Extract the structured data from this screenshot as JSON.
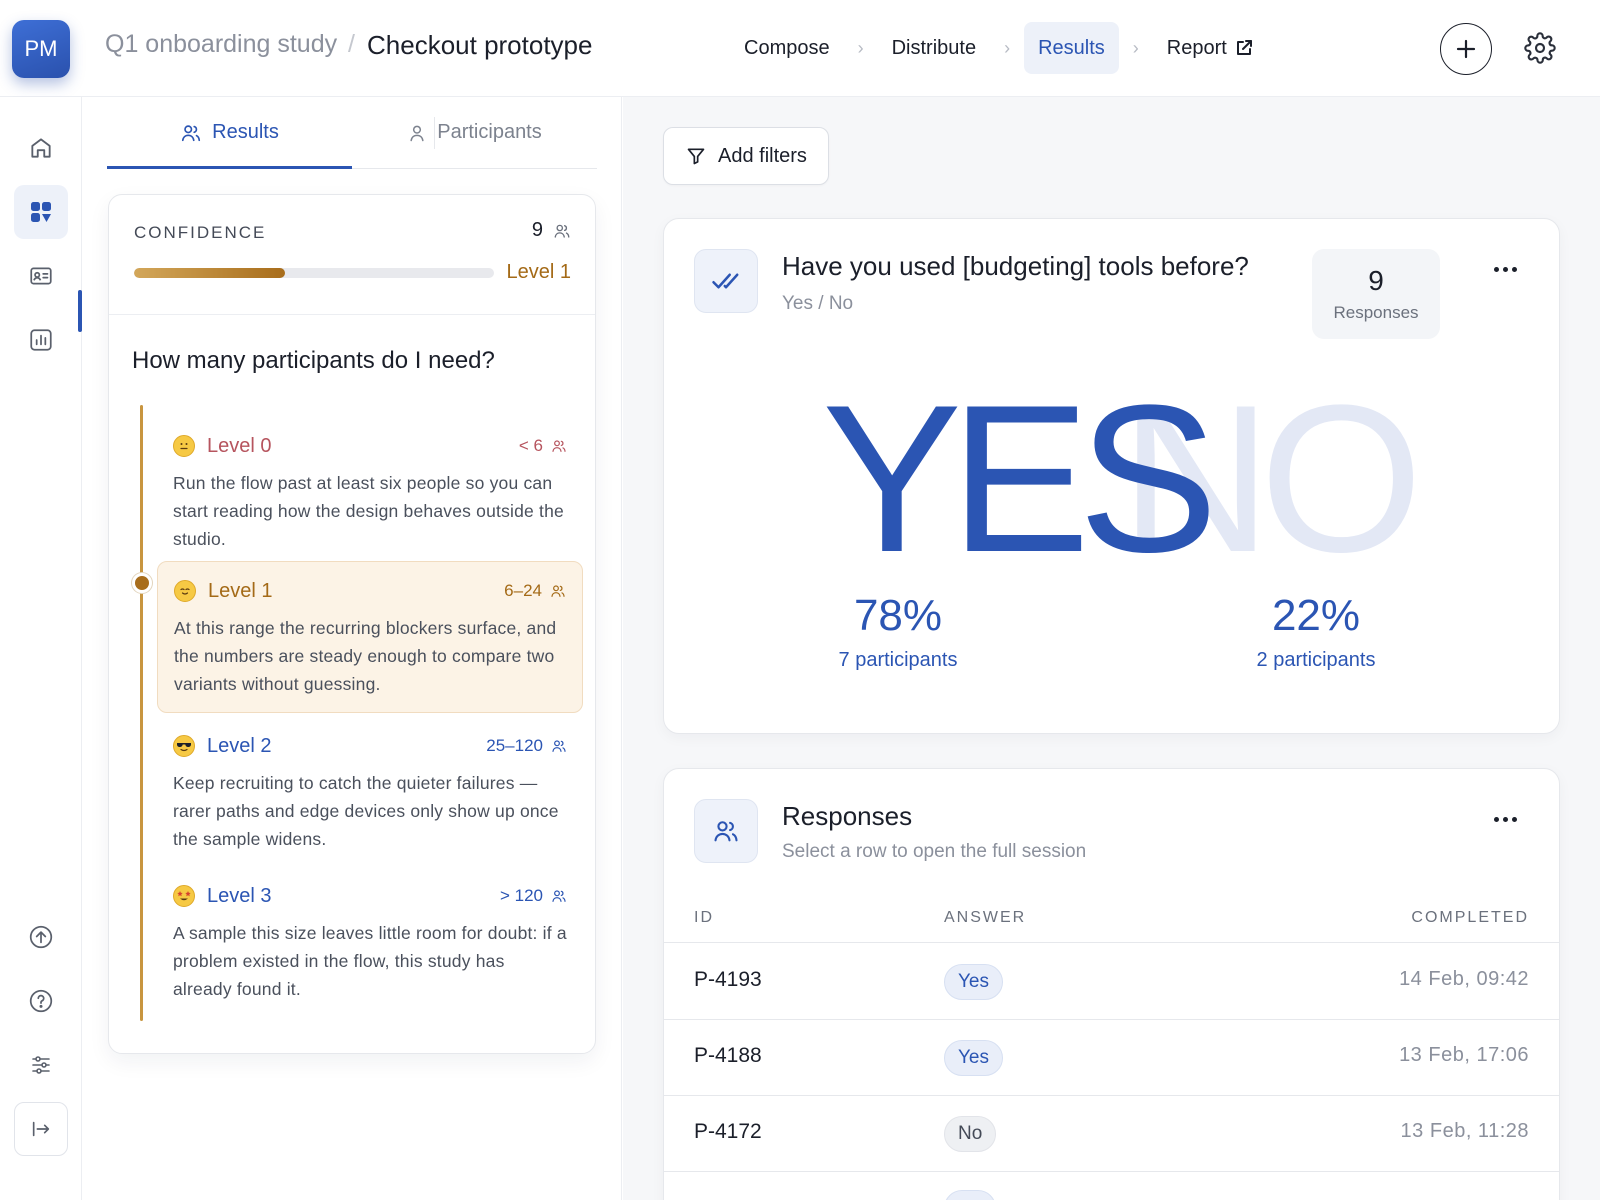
{
  "header": {
    "avatar_initials": "PM",
    "project": "Q1 onboarding study",
    "separator": "/",
    "page": "Checkout prototype",
    "steps": [
      {
        "label": "Compose"
      },
      {
        "label": "Distribute"
      },
      {
        "label": "Results"
      },
      {
        "label": "Report"
      }
    ],
    "active_step": "Results"
  },
  "left_tabs": [
    {
      "label": "Results"
    },
    {
      "label": "Participants"
    }
  ],
  "confidence": {
    "label": "CONFIDENCE",
    "count": "9",
    "progress": 0.42,
    "level": "Level 1",
    "question": "How many participants do I need?",
    "levels": [
      {
        "name": "Level 0",
        "range": "< 6",
        "desc": "Run the flow past at least six people so you can start reading how the design behaves outside the studio."
      },
      {
        "name": "Level 1",
        "range": "6–24",
        "desc": "At this range the recurring blockers surface, and the numbers are steady enough to compare two variants without guessing."
      },
      {
        "name": "Level 2",
        "range": "25–120",
        "desc": "Keep recruiting to catch the quieter failures — rarer paths and edge devices only show up once the sample widens."
      },
      {
        "name": "Level 3",
        "range": "> 120",
        "desc": "A sample this size leaves little room for doubt: if a problem existed in the flow, this study has already found it."
      }
    ]
  },
  "filters": {
    "label": "Add filters"
  },
  "question_card": {
    "title": "Have you used [budgeting] tools before?",
    "subtitle": "Yes / No",
    "responses_count": "9",
    "responses_label": "Responses",
    "yes_word": "YES",
    "no_word": "NO",
    "yes_pct": "78%",
    "yes_participants": "7 participants",
    "no_pct": "22%",
    "no_participants": "2 participants"
  },
  "responses_card": {
    "title": "Responses",
    "subtitle": "Select a row to open the full session",
    "columns": {
      "id": "ID",
      "answer": "ANSWER",
      "completed": "COMPLETED"
    },
    "rows": [
      {
        "id": "P-4193",
        "answer": "Yes",
        "completed": "14 Feb, 09:42"
      },
      {
        "id": "P-4188",
        "answer": "Yes",
        "completed": "13 Feb, 17:06"
      },
      {
        "id": "P-4172",
        "answer": "No",
        "completed": "13 Feb, 11:28"
      }
    ]
  },
  "colors": {
    "accent": "#2b55b3",
    "level_accent": "#a86d1b",
    "no_faded": "#e3e8f5"
  }
}
